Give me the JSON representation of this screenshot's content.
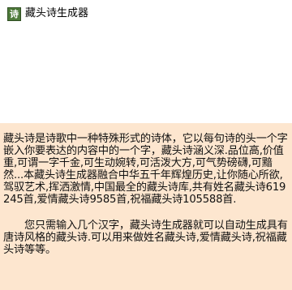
{
  "window": {
    "title": "藏头诗生成器",
    "icon_glyph": "诗",
    "icon_color": "#4e7a3a"
  },
  "description": {
    "background_color": "#fde6cf",
    "paragraph_1": "藏头诗是诗歌中一种特殊形式的诗体，它以每句诗的头一个字嵌入你要表达的内容中的一个字，藏头诗涵义深.品位高,价值重,可谓一字千金,可生动婉转,可活泼大方,可气势磅礴,可黯然...本藏头诗生成器融合中华五千年辉煌历史,让你随心所欲,驾驭艺术,挥洒激情,中国最全的藏头诗库,共有姓名藏头诗619245首,爱情藏头诗9585首,祝福藏头诗105588首.",
    "paragraph_2": "您只需输入几个汉字，藏头诗生成器就可以自动生成具有唐诗风格的藏头诗.可以用来做姓名藏头诗,爱情藏头诗,祝福藏头诗等等。"
  }
}
